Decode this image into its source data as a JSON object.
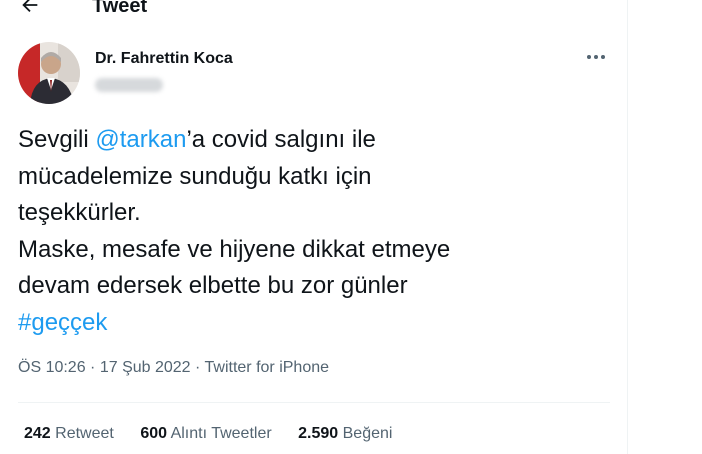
{
  "header": {
    "title": "Tweet"
  },
  "author": {
    "name": "Dr. Fahrettin Koca"
  },
  "tweet": {
    "t1": "Sevgili ",
    "mention": "@tarkan",
    "t2": "’a covid salgını ile\nmücadelemize sunduğu katkı için\nteşekkürler.\nMaske, mesafe ve hijyene dikkat etmeye\ndevam edersek elbette bu zor günler\n",
    "hashtag": "#geççek"
  },
  "meta": {
    "time": "ÖS 10:26",
    "sep1": " · ",
    "date": "17 Şub 2022",
    "sep2": " · ",
    "source": "Twitter for iPhone"
  },
  "stats": {
    "retweets": {
      "num": "242",
      "label": "Retweet"
    },
    "quotes": {
      "num": "600",
      "label": "Alıntı Tweetler"
    },
    "likes": {
      "num": "2.590",
      "label": "Beğeni"
    }
  },
  "colors": {
    "link": "#1d9bf0",
    "secondary_text": "#536471",
    "primary_text": "#0f1419"
  },
  "icons": {
    "back": "arrow-left-icon",
    "more": "more-horizontal-icon"
  }
}
